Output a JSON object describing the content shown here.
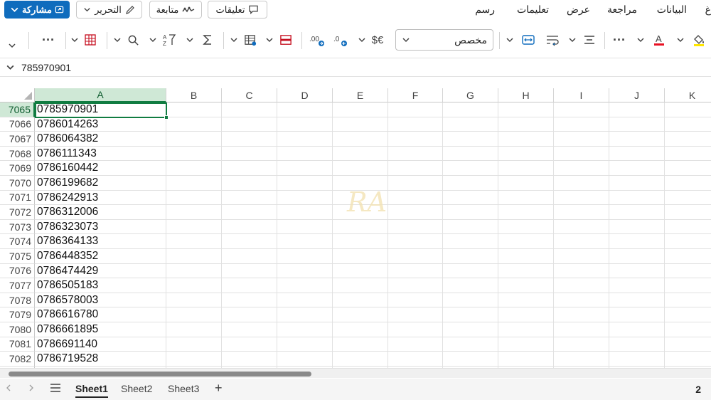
{
  "topbar": {
    "share_label": "مشاركة",
    "edit_label": "التحرير",
    "follow_label": "متابعة",
    "comments_label": "تعليقات",
    "tabs": [
      "غ",
      "البيانات",
      "مراجعة",
      "عرض",
      "تعليمات",
      "رسم"
    ]
  },
  "ribbon": {
    "number_format": "مخصص",
    "currency_symbol": "$€",
    "more": "···"
  },
  "formula_bar": {
    "value": "785970901"
  },
  "grid": {
    "columns": [
      "A",
      "B",
      "C",
      "D",
      "E",
      "F",
      "G",
      "H",
      "I",
      "J",
      "K"
    ],
    "selected_column": "A",
    "selected_row": "7065",
    "rows": [
      {
        "num": "7065",
        "a": "0785970901"
      },
      {
        "num": "7066",
        "a": "0786014263"
      },
      {
        "num": "7067",
        "a": "0786064382"
      },
      {
        "num": "7068",
        "a": "0786111343"
      },
      {
        "num": "7069",
        "a": "0786160442"
      },
      {
        "num": "7070",
        "a": "0786199682"
      },
      {
        "num": "7071",
        "a": "0786242913"
      },
      {
        "num": "7072",
        "a": "0786312006"
      },
      {
        "num": "7073",
        "a": "0786323073"
      },
      {
        "num": "7074",
        "a": "0786364133"
      },
      {
        "num": "7075",
        "a": "0786448352"
      },
      {
        "num": "7076",
        "a": "0786474429"
      },
      {
        "num": "7077",
        "a": "0786505183"
      },
      {
        "num": "7078",
        "a": "0786578003"
      },
      {
        "num": "7079",
        "a": "0786616780"
      },
      {
        "num": "7080",
        "a": "0786661895"
      },
      {
        "num": "7081",
        "a": "0786691140"
      },
      {
        "num": "7082",
        "a": "0786719528"
      }
    ],
    "watermark": "RA"
  },
  "sheets": {
    "tabs": [
      "Sheet1",
      "Sheet2",
      "Sheet3"
    ],
    "active": "Sheet1",
    "add_label": "+",
    "page_number": "2"
  },
  "colors": {
    "accent": "#107c41",
    "share": "#0f6cbd",
    "font_color_bar": "#e81123",
    "fill_color_bar": "#ffe600"
  }
}
